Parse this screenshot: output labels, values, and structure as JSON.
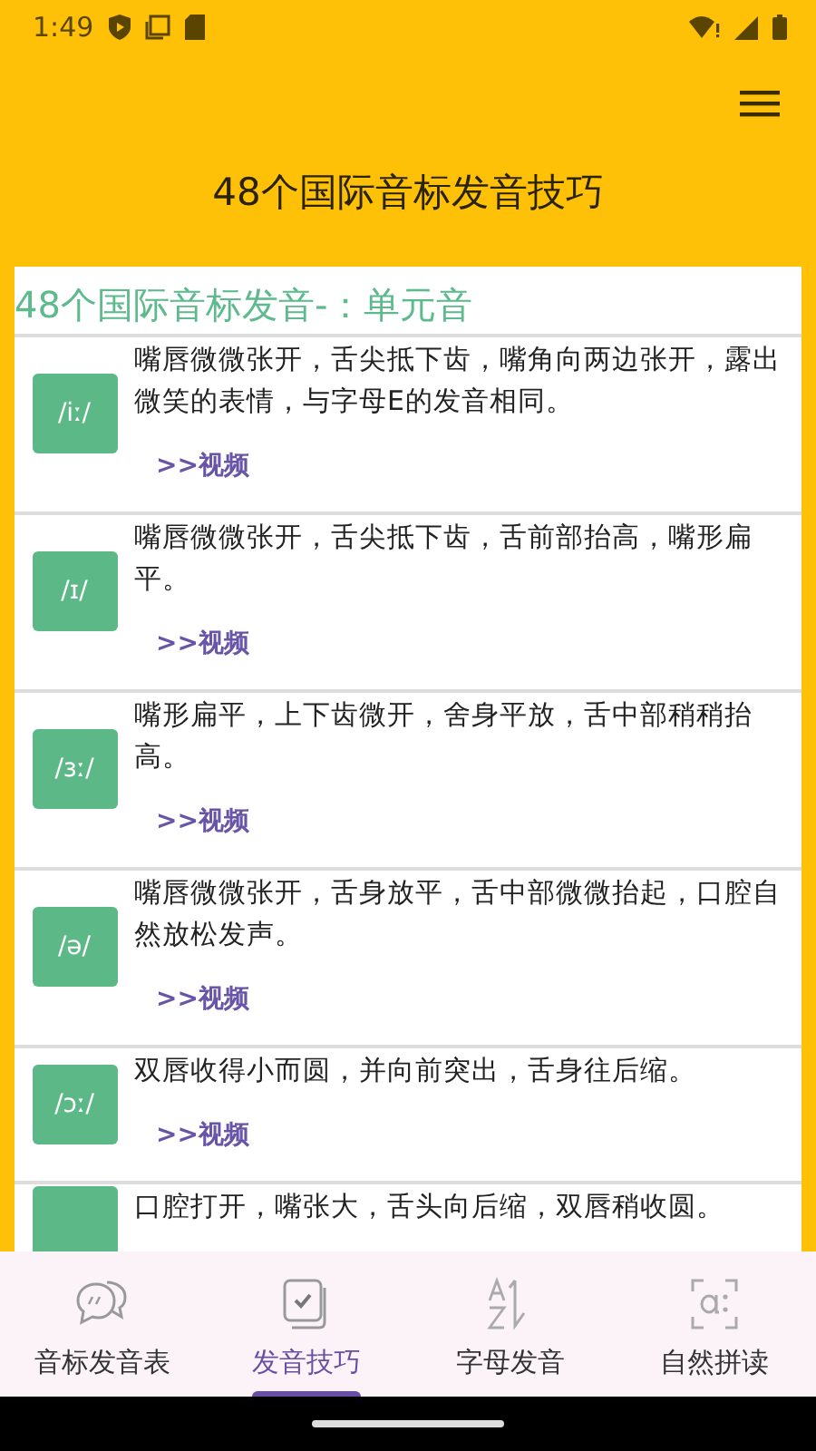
{
  "status_bar": {
    "time": "1:49"
  },
  "toolbar": {
    "title": "48个国际音标发音技巧"
  },
  "section": {
    "heading": "48个国际音标发音-：单元音",
    "items": [
      {
        "phonetic": "/iː/",
        "description": "嘴唇微微张开，舌尖抵下齿，嘴角向两边张开，露出微笑的表情，与字母E的发音相同。",
        "link": ">>视频"
      },
      {
        "phonetic": "/ɪ/",
        "description": "嘴唇微微张开，舌尖抵下齿，舌前部抬高，嘴形扁平。",
        "link": ">>视频"
      },
      {
        "phonetic": "/ɜː/",
        "description": "嘴形扁平，上下齿微开，舍身平放，舌中部稍稍抬高。",
        "link": ">>视频"
      },
      {
        "phonetic": "/ə/",
        "description": "嘴唇微微张开，舌身放平，舌中部微微抬起，口腔自然放松发声。",
        "link": ">>视频"
      },
      {
        "phonetic": "/ɔː/",
        "description": "双唇收得小而圆，并向前突出，舌身往后缩。",
        "link": ">>视频"
      },
      {
        "description": "口腔打开，嘴张大，舌头向后缩，双唇稍收圆。"
      }
    ]
  },
  "bottom_nav": [
    {
      "label": "音标发音表",
      "selected": false
    },
    {
      "label": "发音技巧",
      "selected": true
    },
    {
      "label": "字母发音",
      "selected": false
    },
    {
      "label": "自然拼读",
      "selected": false
    }
  ]
}
